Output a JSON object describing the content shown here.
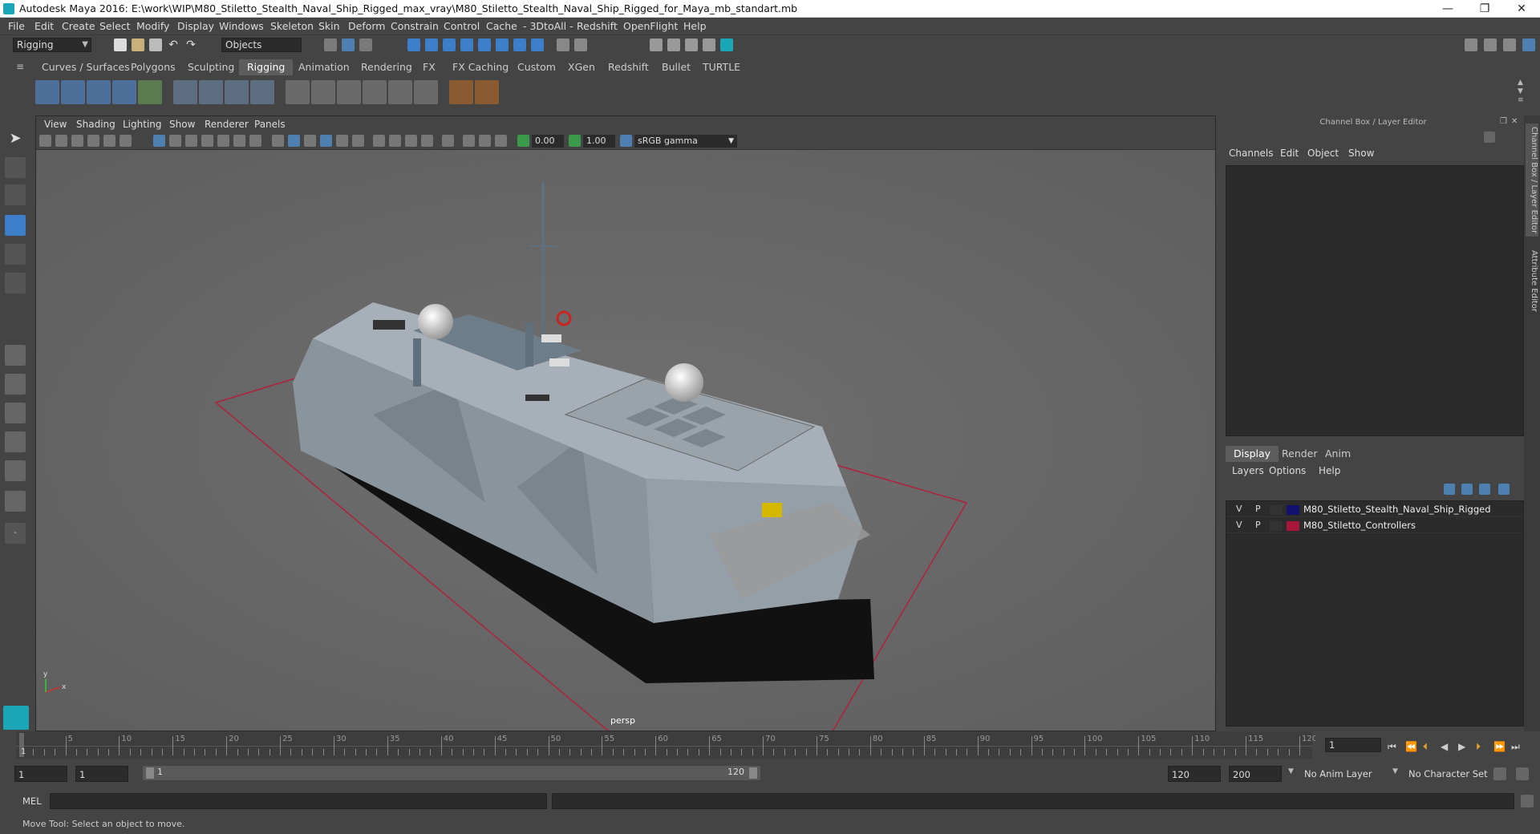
{
  "window": {
    "title": "Autodesk Maya 2016: E:\\work\\WIP\\M80_Stiletto_Stealth_Naval_Ship_Rigged_max_vray\\M80_Stiletto_Stealth_Naval_Ship_Rigged_for_Maya_mb_standart.mb",
    "minimize": "—",
    "restore": "❐",
    "close": "✕"
  },
  "menu": [
    "File",
    "Edit",
    "Create",
    "Select",
    "Modify",
    "Display",
    "Windows",
    "Skeleton",
    "Skin",
    "Deform",
    "Constrain",
    "Control",
    "Cache",
    "- 3DtoAll -",
    "Redshift",
    "OpenFlight",
    "Help"
  ],
  "statusline": {
    "mode": "Rigging",
    "selection_mode": "Objects"
  },
  "shelf_tabs": [
    "Curves / Surfaces",
    "Polygons",
    "Sculpting",
    "Rigging",
    "Animation",
    "Rendering",
    "FX",
    "FX Caching",
    "Custom",
    "XGen",
    "Redshift",
    "Bullet",
    "TURTLE"
  ],
  "active_shelf_tab": "Rigging",
  "viewport": {
    "menu": [
      "View",
      "Shading",
      "Lighting",
      "Show",
      "Renderer",
      "Panels"
    ],
    "exposure": "0.00",
    "gamma": "1.00",
    "color_space": "sRGB gamma",
    "camera_label": "persp",
    "axis_x": "x",
    "axis_y": "y"
  },
  "channel_box": {
    "header": "Channel Box / Layer Editor",
    "menu": [
      "Channels",
      "Edit",
      "Object",
      "Show"
    ]
  },
  "layer_editor": {
    "tabs": [
      "Display",
      "Render",
      "Anim"
    ],
    "active_tab": "Display",
    "menu": [
      "Layers",
      "Options",
      "Help"
    ],
    "layers": [
      {
        "v": "V",
        "p": "P",
        "name": "M80_Stiletto_Stealth_Naval_Ship_Rigged",
        "color": "#12126e"
      },
      {
        "v": "V",
        "p": "P",
        "name": "M80_Stiletto_Controllers",
        "color": "#a8163a"
      }
    ]
  },
  "side_tabs": [
    "Channel Box / Layer Editor",
    "Attribute Editor"
  ],
  "timeline": {
    "labels": [
      "5",
      "10",
      "15",
      "20",
      "25",
      "30",
      "35",
      "40",
      "45",
      "50",
      "55",
      "60",
      "65",
      "70",
      "75",
      "80",
      "85",
      "90",
      "95",
      "100",
      "105",
      "110",
      "115",
      "120"
    ],
    "start_label": "1",
    "current_frame": "1"
  },
  "range": {
    "start": "1",
    "anim_start": "1",
    "slider_start": "1",
    "slider_end": "120",
    "end": "120",
    "anim_end": "200",
    "anim_layer": "No Anim Layer",
    "character_set": "No Character Set"
  },
  "command_line": {
    "label": "MEL"
  },
  "help_line": "Move Tool: Select an object to move."
}
